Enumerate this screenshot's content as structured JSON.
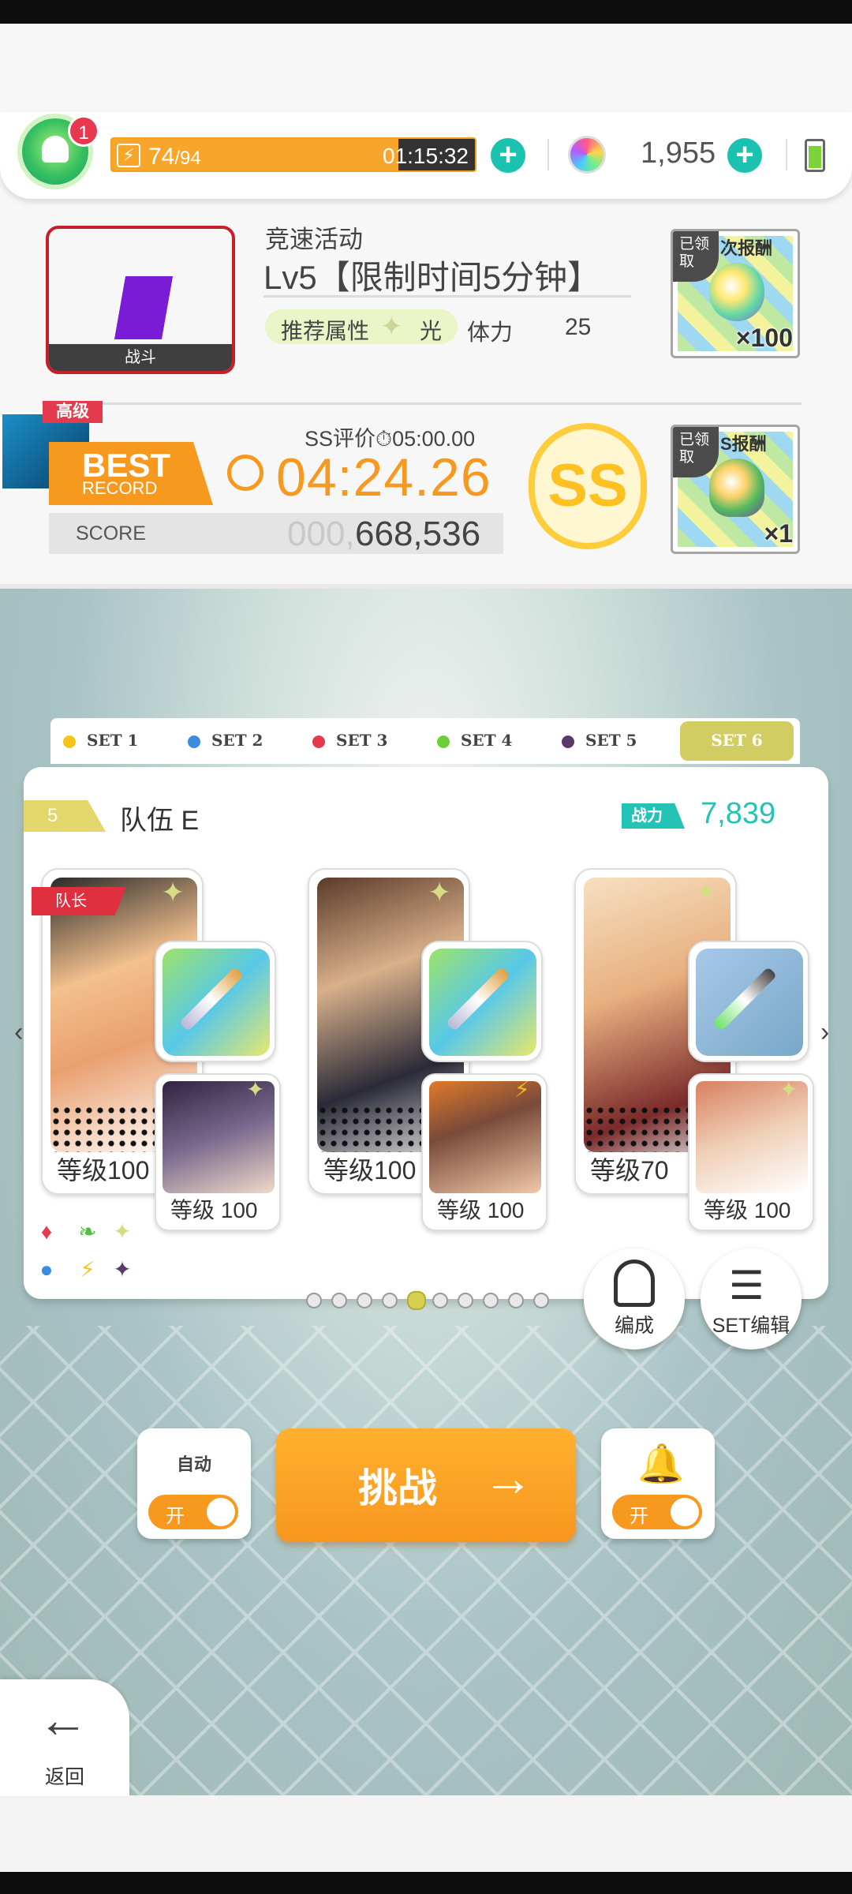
{
  "topbar": {
    "notification_count": "1",
    "stamina_current": "74",
    "stamina_max": "/94",
    "stamina_fraction": 0.79,
    "stamina_timer": "01:15:32",
    "gem_count": "1,955",
    "battery_icon": "battery-icon"
  },
  "event": {
    "title": "竞速活动",
    "level": "Lv5【限制时间5分钟】",
    "boss_label": "战斗",
    "attr_label": "推荐属性",
    "attr_element": "光",
    "stamina_label": "体力",
    "stamina_cost": "25"
  },
  "rewards": [
    {
      "header": "次报酬",
      "claimed": "已领取",
      "count": "×100"
    },
    {
      "header": "S报酬",
      "claimed": "已领取",
      "count": "×1"
    }
  ],
  "record": {
    "difficulty_badge": "高级",
    "best_label": "BEST",
    "record_label": "RECORD",
    "ss_limit": "SS评价⏱05:00.00",
    "best_time": "04:24.26",
    "score_label": "SCORE",
    "score_padding": "000,",
    "score_value": "668,536",
    "rank": "SS"
  },
  "set_tabs": [
    {
      "label": "SET 1",
      "color": "#f5c517"
    },
    {
      "label": "SET 2",
      "color": "#3b8ce0"
    },
    {
      "label": "SET 3",
      "color": "#e53a4e"
    },
    {
      "label": "SET 4",
      "color": "#6ccf38"
    },
    {
      "label": "SET 5",
      "color": "#5a3a6a"
    },
    {
      "label": "SET 6",
      "color": "#d2cd63"
    }
  ],
  "party": {
    "number": "5",
    "name": "队伍 E",
    "power_label": "战力",
    "power_value": "7,839",
    "leader_label": "队长",
    "members": [
      {
        "level": "等级100",
        "sub_level": "等级 100"
      },
      {
        "level": "等级100",
        "sub_level": "等级 100"
      },
      {
        "level": "等级70",
        "sub_level": "等级 100"
      }
    ],
    "page_dots": 10,
    "active_page": 5
  },
  "buttons": {
    "formation": "编成",
    "set_edit": "SET编辑",
    "auto_label": "自动",
    "auto_state": "开",
    "challenge": "挑战",
    "notify_state": "开",
    "back": "返回"
  }
}
